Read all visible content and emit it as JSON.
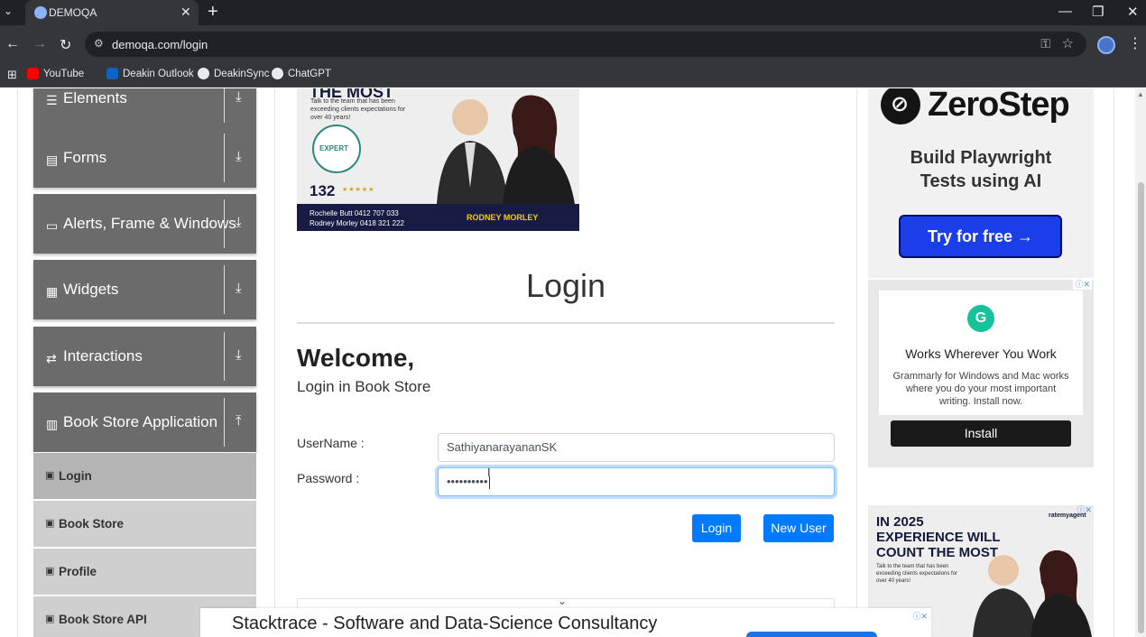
{
  "browser": {
    "tab_title": "DEMOQA",
    "url": "demoqa.com/login",
    "bookmarks": [
      {
        "label": "YouTube",
        "color": "#ff0000"
      },
      {
        "label": "Deakin Outlook",
        "color": "#0a66c2"
      },
      {
        "label": "DeakinSync",
        "color": "#e8eaed"
      },
      {
        "label": "ChatGPT",
        "color": "#e8eaed"
      }
    ]
  },
  "sidebar": {
    "groups": [
      {
        "label": "Elements",
        "icon": "menu-icon",
        "arrow": "⤓"
      },
      {
        "label": "Forms",
        "icon": "document-icon",
        "arrow": "⤓"
      },
      {
        "label": "Alerts, Frame & Windows",
        "icon": "window-icon",
        "arrow": "⤓"
      },
      {
        "label": "Widgets",
        "icon": "grid-icon",
        "arrow": "⤓"
      },
      {
        "label": "Interactions",
        "icon": "swap-icon",
        "arrow": "⤓"
      },
      {
        "label": "Book Store Application",
        "icon": "books-icon",
        "arrow": "⤒"
      }
    ],
    "items": [
      {
        "label": "Login",
        "active": true
      },
      {
        "label": "Book Store",
        "active": false
      },
      {
        "label": "Profile",
        "active": false
      },
      {
        "label": "Book Store API",
        "active": false
      }
    ]
  },
  "ads": {
    "top": {
      "headline": "THE MOST",
      "sub": "Talk to the team that has been exceeding clients expectations for over 40 years!",
      "badge": "EXPERT",
      "reviews": "132",
      "contact1": "Rochelle Butt  0412 707 033",
      "contact2": "Rodney Morley  0418 321 222",
      "brand": "RODNEY MORLEY"
    },
    "zerostep": {
      "name": "ZeroStep",
      "tagline1": "Build Playwright",
      "tagline2": "Tests using AI",
      "button": "Try for free →"
    },
    "grammarly": {
      "title": "Works Wherever You Work",
      "desc": "Grammarly for Windows and Mac works where you do your most important writing. Install now.",
      "button": "Install"
    },
    "bottom_right": {
      "headline": "IN 2025 EXPERIENCE WILL COUNT THE MOST",
      "sub": "Talk to the team that has been exceeding clients expectations for over 40 years!",
      "logo": "ratemyagent"
    },
    "banner": "Stacktrace - Software and Data-Science Consultancy"
  },
  "login": {
    "title": "Login",
    "welcome": "Welcome,",
    "subtitle": "Login in Book Store",
    "username_label": "UserName :",
    "username_value": "SathiyanarayananSK",
    "password_label": "Password :",
    "password_value": "••••••••••",
    "login_button": "Login",
    "new_user_button": "New User"
  }
}
